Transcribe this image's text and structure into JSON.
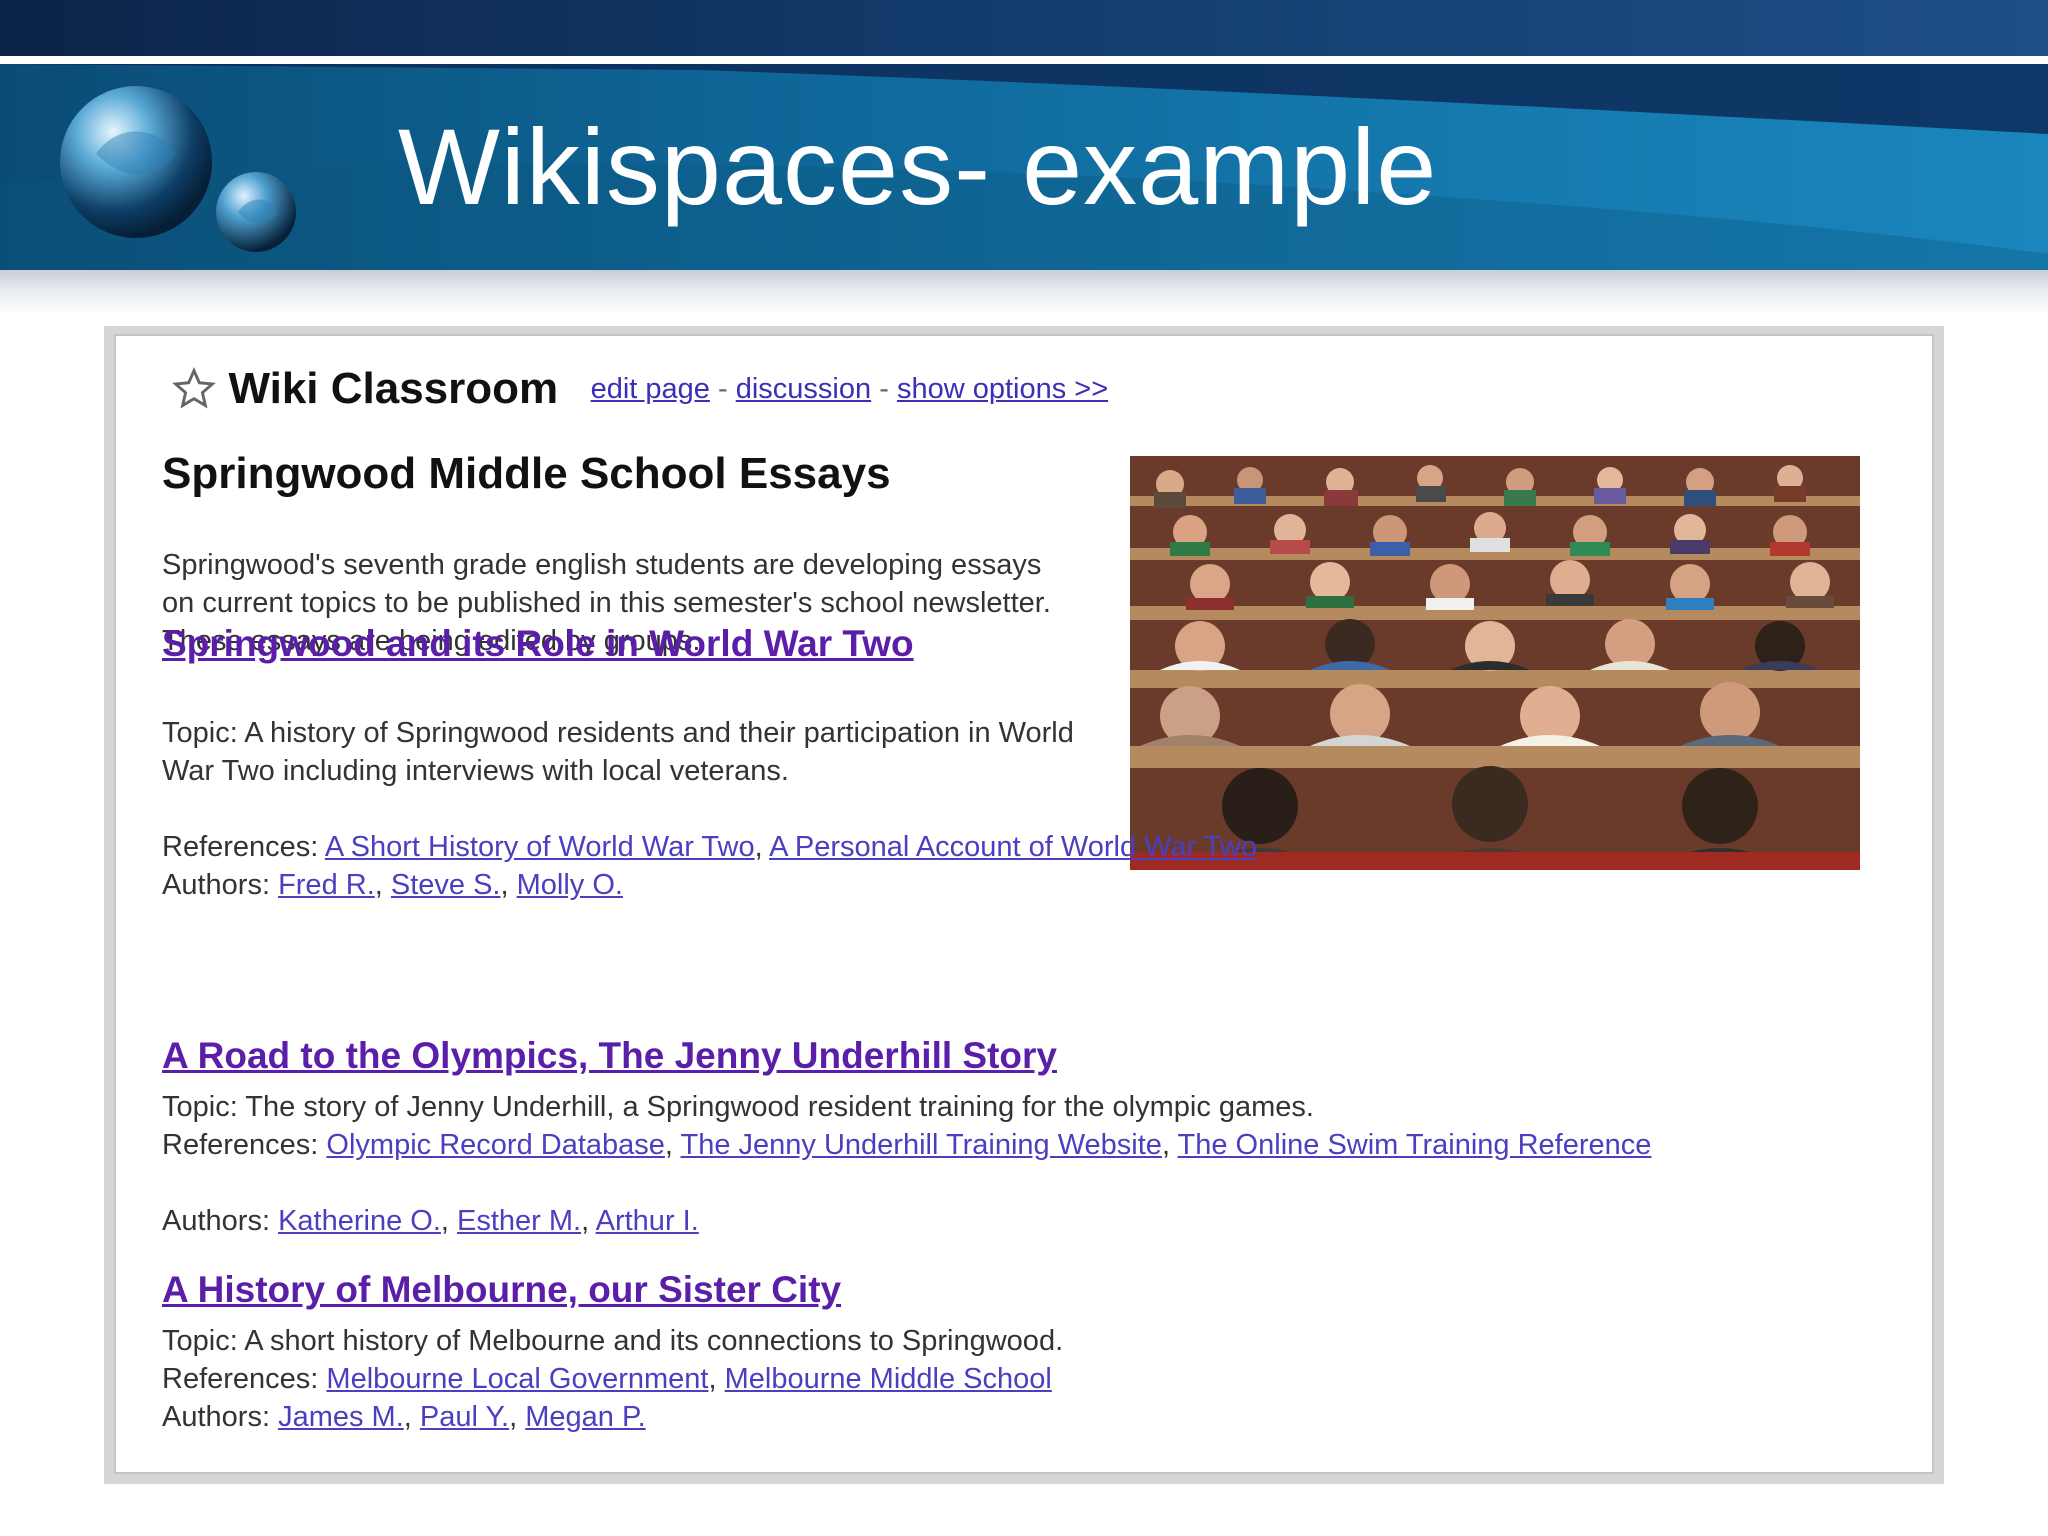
{
  "slide": {
    "title": "Wikispaces- example"
  },
  "wiki": {
    "title": "Wiki Classroom",
    "links": [
      {
        "label": "edit page"
      },
      {
        "label": "discussion"
      },
      {
        "label": "show options >>"
      }
    ],
    "link_separator": "-",
    "page_heading": "Springwood Middle School Essays",
    "intro": "Springwood's seventh grade english students are developing essays on current topics to be published in this semester's school newsletter. These essays are being edited by groups."
  },
  "labels": {
    "references": "References:",
    "authors": "Authors:"
  },
  "essays": [
    {
      "title": "Springwood and its Role in World War Two",
      "topic": "Topic: A history of Springwood residents and their participation in World War Two including interviews with local veterans.",
      "references": [
        "A Short History of World War Two",
        "A Personal Account of World War Two"
      ],
      "authors": [
        "Fred R.",
        "Steve S.",
        "Molly O."
      ]
    },
    {
      "title": "A Road to the Olympics, The Jenny Underhill Story",
      "topic": "Topic: The story of Jenny Underhill, a Springwood resident training for the olympic games.",
      "references": [
        "Olympic Record Database",
        "The Jenny Underhill Training Website",
        "The Online Swim Training Reference"
      ],
      "authors": [
        "Katherine O.",
        "Esther M.",
        "Arthur I."
      ]
    },
    {
      "title": "A History of Melbourne, our Sister City",
      "topic": "Topic: A short history of Melbourne and its connections to Springwood.",
      "references": [
        "Melbourne Local Government",
        "Melbourne Middle School"
      ],
      "authors": [
        "James M.",
        "Paul Y.",
        "Megan P."
      ]
    }
  ],
  "icons": {
    "star": "star-outline-icon",
    "logo": "globe-logo-icon",
    "photo": "classroom-photo"
  },
  "colors": {
    "banner": "#0e6596",
    "link": "#4b3fc0",
    "essay_title": "#5a1ea8"
  }
}
